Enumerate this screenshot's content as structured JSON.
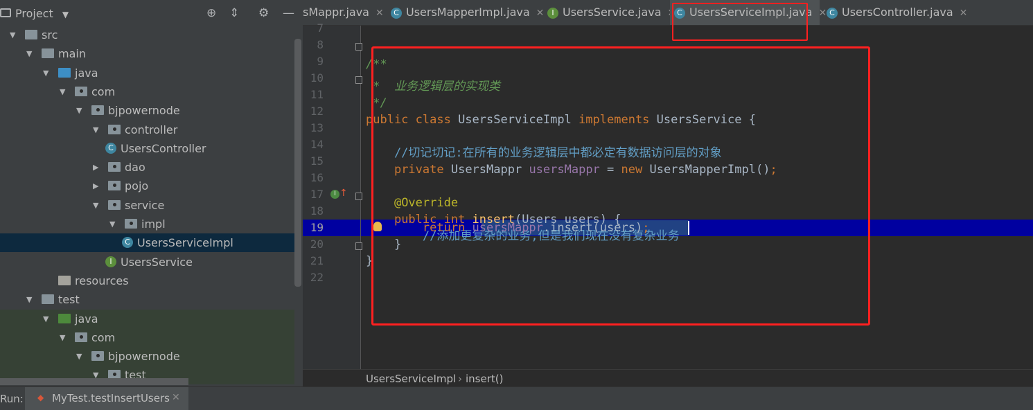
{
  "project_panel": {
    "title": "Project",
    "tree": [
      {
        "label": "src",
        "depth": 0,
        "expanded": true,
        "kind": "folder"
      },
      {
        "label": "main",
        "depth": 1,
        "expanded": true,
        "kind": "folder"
      },
      {
        "label": "java",
        "depth": 2,
        "expanded": true,
        "kind": "source-folder"
      },
      {
        "label": "com",
        "depth": 3,
        "expanded": true,
        "kind": "package"
      },
      {
        "label": "bjpowernode",
        "depth": 4,
        "expanded": true,
        "kind": "package"
      },
      {
        "label": "controller",
        "depth": 5,
        "expanded": true,
        "kind": "package"
      },
      {
        "label": "UsersController",
        "depth": 6,
        "kind": "class"
      },
      {
        "label": "dao",
        "depth": 5,
        "expanded": false,
        "kind": "package"
      },
      {
        "label": "pojo",
        "depth": 5,
        "expanded": false,
        "kind": "package"
      },
      {
        "label": "service",
        "depth": 5,
        "expanded": true,
        "kind": "package"
      },
      {
        "label": "impl",
        "depth": 6,
        "expanded": true,
        "kind": "package"
      },
      {
        "label": "UsersServiceImpl",
        "depth": 7,
        "kind": "class",
        "selected": true
      },
      {
        "label": "UsersService",
        "depth": 6,
        "kind": "interface"
      },
      {
        "label": "resources",
        "depth": 2,
        "kind": "resources"
      },
      {
        "label": "test",
        "depth": 1,
        "expanded": true,
        "kind": "folder"
      },
      {
        "label": "java",
        "depth": 2,
        "expanded": true,
        "kind": "test-folder"
      },
      {
        "label": "com",
        "depth": 3,
        "expanded": true,
        "kind": "package"
      },
      {
        "label": "bjpowernode",
        "depth": 4,
        "expanded": true,
        "kind": "package"
      },
      {
        "label": "test",
        "depth": 5,
        "expanded": true,
        "kind": "package"
      }
    ]
  },
  "tabs": [
    {
      "label": "sMappr.java",
      "icon": "none"
    },
    {
      "label": "UsersMapperImpl.java",
      "icon": "C"
    },
    {
      "label": "UsersService.java",
      "icon": "I"
    },
    {
      "label": "UsersServiceImpl.java",
      "icon": "C",
      "active": true
    },
    {
      "label": "UsersController.java",
      "icon": "C"
    }
  ],
  "editor": {
    "line_numbers": [
      "7",
      "8",
      "9",
      "10",
      "11",
      "12",
      "13",
      "14",
      "15",
      "16",
      "17",
      "18",
      "19",
      "20",
      "21",
      "22"
    ],
    "current_line": "19",
    "lines": [
      "",
      "/**",
      " *  业务逻辑层的实现类",
      " */",
      "public class UsersServiceImpl implements UsersService {",
      "",
      "    //切记切记:在所有的业务逻辑层中都必定有数据访问层的对象",
      "    private UsersMappr usersMappr = new UsersMapperImpl();",
      "",
      "    @Override",
      "    public int insert(Users users) {",
      "        //添加更复杂的业务,但是我们现在没有复杂业务",
      "        return usersMappr.insert(users);",
      "    }",
      "}",
      ""
    ]
  },
  "breadcrumb": [
    "UsersServiceImpl",
    "insert()"
  ],
  "run_bar": {
    "label": "Run:",
    "tab_label": "MyTest.testInsertUsers"
  },
  "colors": {
    "highlight_box": "#ff2020",
    "current_line": "#0000a0",
    "selection": "#214283"
  }
}
